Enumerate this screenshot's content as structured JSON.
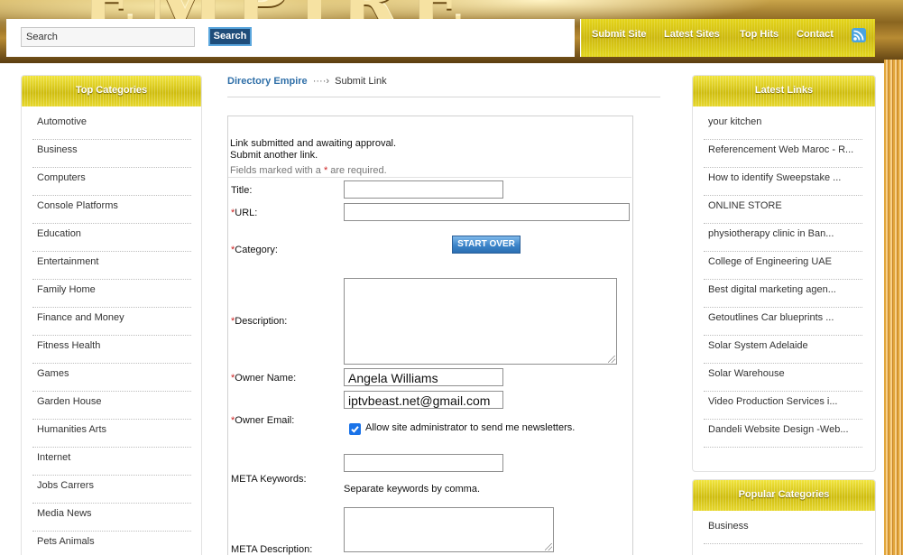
{
  "header": {
    "banner_text": "EMPIRE",
    "search_value": "Search",
    "search_button": "Search",
    "nav": [
      {
        "label": "Submit Site"
      },
      {
        "label": "Latest Sites"
      },
      {
        "label": "Top Hits"
      },
      {
        "label": "Contact"
      }
    ],
    "rss_icon": "rss-icon"
  },
  "left_sidebar": {
    "title": "Top Categories",
    "items": [
      "Automotive",
      "Business",
      "Computers",
      "Console Platforms",
      "Education",
      "Entertainment",
      "Family Home",
      "Finance and Money",
      "Fitness Health",
      "Games",
      "Garden House",
      "Humanities Arts",
      "Internet",
      "Jobs Carrers",
      "Media News",
      "Pets Animals"
    ]
  },
  "right_sidebar": {
    "latest_title": "Latest Links",
    "latest_items": [
      "your kitchen",
      "Referencement Web Maroc - R...",
      "How to identify Sweepstake ...",
      "ONLINE STORE",
      "physiotherapy clinic in Ban...",
      "College of Engineering UAE",
      "Best digital marketing agen...",
      "Getoutlines Car blueprints ...",
      "Solar System Adelaide",
      "Solar Warehouse",
      "Video Production Services i...",
      "Dandeli Website Design -Web..."
    ],
    "popular_title": "Popular Categories",
    "popular_items": [
      "Business"
    ]
  },
  "breadcrumb": {
    "home": "Directory Empire",
    "separator": "····›",
    "current": "Submit Link"
  },
  "form": {
    "message_line1": "Link submitted and awaiting approval.",
    "message_line2": "Submit another link.",
    "required_note_prefix": "Fields marked with a ",
    "required_star": "*",
    "required_note_suffix": " are required.",
    "title_label": "Title:",
    "url_label": "URL:",
    "category_label": "Category:",
    "start_over_button": "START OVER",
    "description_label": "Description:",
    "owner_name_label": "Owner Name:",
    "owner_name_value": "Angela Williams",
    "owner_email_label": "Owner Email:",
    "owner_email_value": "iptvbeast.net@gmail.com",
    "newsletter_label": "Allow site administrator to send me newsletters.",
    "newsletter_checked": true,
    "meta_keywords_label": "META Keywords:",
    "meta_keywords_hint": "Separate keywords by comma.",
    "meta_description_label": "META Description:"
  }
}
